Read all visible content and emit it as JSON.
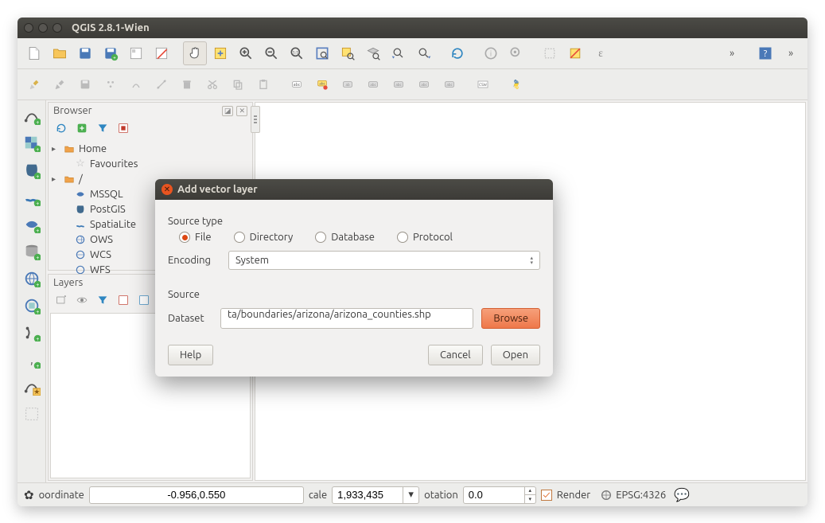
{
  "window": {
    "title": "QGIS 2.8.1-Wien"
  },
  "browser": {
    "title": "Browser",
    "items": [
      {
        "label": "Home",
        "icon": "folder-orange",
        "expandable": true
      },
      {
        "label": "Favourites",
        "icon": "star"
      },
      {
        "label": "/",
        "icon": "folder-orange",
        "expandable": true
      },
      {
        "label": "MSSQL",
        "icon": "mssql"
      },
      {
        "label": "PostGIS",
        "icon": "postgis"
      },
      {
        "label": "SpatiaLite",
        "icon": "spatialite"
      },
      {
        "label": "OWS",
        "icon": "globe"
      },
      {
        "label": "WCS",
        "icon": "globe"
      },
      {
        "label": "WFS",
        "icon": "globe"
      }
    ]
  },
  "layers": {
    "title": "Layers"
  },
  "dialog": {
    "title": "Add vector layer",
    "source_type_label": "Source type",
    "radios": {
      "file": "File",
      "directory": "Directory",
      "database": "Database",
      "protocol": "Protocol"
    },
    "encoding_label": "Encoding",
    "encoding_value": "System",
    "source_label": "Source",
    "dataset_label": "Dataset",
    "dataset_value": "ta/boundaries/arizona/arizona_counties.shp",
    "browse": "Browse",
    "help": "Help",
    "cancel": "Cancel",
    "open": "Open"
  },
  "status": {
    "coord_label": "oordinate",
    "coord_value": "-0.956,0.550",
    "scale_label": "cale",
    "scale_value": "1,933,435",
    "rotation_label": "otation",
    "rotation_value": "0.0",
    "render_label": "Render",
    "crs": "EPSG:4326"
  }
}
